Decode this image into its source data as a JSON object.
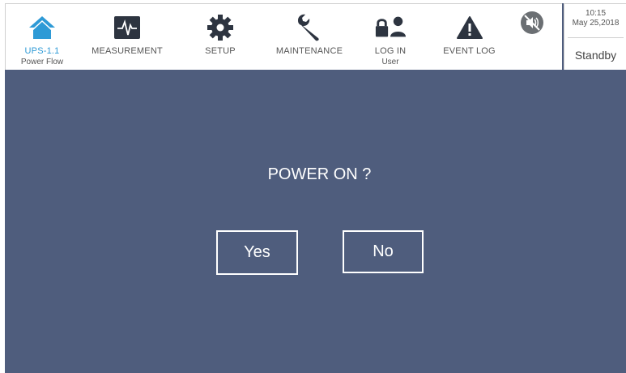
{
  "nav": {
    "items": [
      {
        "label": "UPS-1.1",
        "sublabel": "Power Flow",
        "icon": "home-icon",
        "active": true
      },
      {
        "label": "MEASUREMENT",
        "icon": "waveform-icon"
      },
      {
        "label": "SETUP",
        "icon": "gear-icon"
      },
      {
        "label": "MAINTENANCE",
        "icon": "wrench-icon"
      },
      {
        "label": "LOG IN",
        "sublabel": "User",
        "icon": "lock-user-icon"
      },
      {
        "label": "EVENT LOG",
        "icon": "warning-icon"
      },
      {
        "icon": "mute-icon"
      }
    ]
  },
  "status": {
    "time": "10:15",
    "date": "May 25,2018",
    "state": "Standby"
  },
  "dialog": {
    "question": "POWER ON ?",
    "yes_label": "Yes",
    "no_label": "No"
  },
  "colors": {
    "background": "#4f5d7d",
    "accent": "#2e9ad6",
    "icon_dark": "#2d3440",
    "panel": "#ffffff"
  }
}
